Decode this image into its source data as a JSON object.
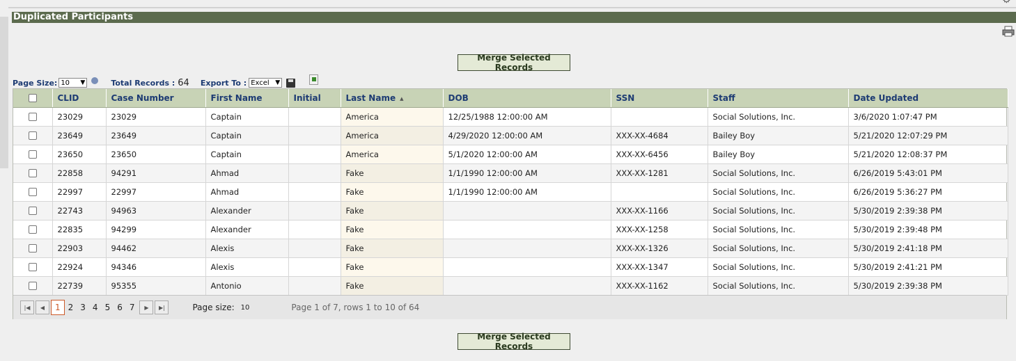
{
  "title": "Duplicated Participants",
  "merge_label": "Merge Selected Records",
  "toolbar": {
    "page_size_label": "Page Size:",
    "page_size_value": "10",
    "total_label": "Total Records :",
    "total_value": "64",
    "export_label": "Export To :",
    "export_value": "Excel"
  },
  "columns": [
    "CLID",
    "Case Number",
    "First Name",
    "Initial",
    "Last Name",
    "DOB",
    "SSN",
    "Staff",
    "Date Updated"
  ],
  "rows": [
    {
      "clid": "23029",
      "case": "23029",
      "first": "Captain",
      "initial": "",
      "last": "America",
      "dob": "12/25/1988 12:00:00 AM",
      "ssn": "",
      "staff": "Social Solutions, Inc.",
      "updated": "3/6/2020 1:07:47 PM"
    },
    {
      "clid": "23649",
      "case": "23649",
      "first": "Captain",
      "initial": "",
      "last": "America",
      "dob": "4/29/2020 12:00:00 AM",
      "ssn": "XXX-XX-4684",
      "staff": "Bailey Boy",
      "updated": "5/21/2020 12:07:29 PM"
    },
    {
      "clid": "23650",
      "case": "23650",
      "first": "Captain",
      "initial": "",
      "last": "America",
      "dob": "5/1/2020 12:00:00 AM",
      "ssn": "XXX-XX-6456",
      "staff": "Bailey Boy",
      "updated": "5/21/2020 12:08:37 PM"
    },
    {
      "clid": "22858",
      "case": "94291",
      "first": "Ahmad",
      "initial": "",
      "last": "Fake",
      "dob": "1/1/1990 12:00:00 AM",
      "ssn": "XXX-XX-1281",
      "staff": "Social Solutions, Inc.",
      "updated": "6/26/2019 5:43:01 PM"
    },
    {
      "clid": "22997",
      "case": "22997",
      "first": "Ahmad",
      "initial": "",
      "last": "Fake",
      "dob": "1/1/1990 12:00:00 AM",
      "ssn": "",
      "staff": "Social Solutions, Inc.",
      "updated": "6/26/2019 5:36:27 PM"
    },
    {
      "clid": "22743",
      "case": "94963",
      "first": "Alexander",
      "initial": "",
      "last": "Fake",
      "dob": "",
      "ssn": "XXX-XX-1166",
      "staff": "Social Solutions, Inc.",
      "updated": "5/30/2019 2:39:38 PM"
    },
    {
      "clid": "22835",
      "case": "94299",
      "first": "Alexander",
      "initial": "",
      "last": "Fake",
      "dob": "",
      "ssn": "XXX-XX-1258",
      "staff": "Social Solutions, Inc.",
      "updated": "5/30/2019 2:39:48 PM"
    },
    {
      "clid": "22903",
      "case": "94462",
      "first": "Alexis",
      "initial": "",
      "last": "Fake",
      "dob": "",
      "ssn": "XXX-XX-1326",
      "staff": "Social Solutions, Inc.",
      "updated": "5/30/2019 2:41:18 PM"
    },
    {
      "clid": "22924",
      "case": "94346",
      "first": "Alexis",
      "initial": "",
      "last": "Fake",
      "dob": "",
      "ssn": "XXX-XX-1347",
      "staff": "Social Solutions, Inc.",
      "updated": "5/30/2019 2:41:21 PM"
    },
    {
      "clid": "22739",
      "case": "95355",
      "first": "Antonio",
      "initial": "",
      "last": "Fake",
      "dob": "",
      "ssn": "XXX-XX-1162",
      "staff": "Social Solutions, Inc.",
      "updated": "5/30/2019 2:39:38 PM"
    }
  ],
  "pager": {
    "pages": [
      "1",
      "2",
      "3",
      "4",
      "5",
      "6",
      "7"
    ],
    "current": "1",
    "size_label": "Page size:",
    "size_value": "10",
    "info": "Page 1 of 7, rows 1 to 10 of 64"
  },
  "icons": {
    "gear": "gear-icon",
    "print": "print-icon",
    "help": "help-icon",
    "save": "save-icon",
    "export": "excel-export-icon",
    "sort": "sort-ascending-icon"
  },
  "colors": {
    "title_bar": "#5c6b4e",
    "header_bg": "#c8d3b6",
    "header_text": "#1d3b73",
    "current_page": "#cc5a2a"
  }
}
